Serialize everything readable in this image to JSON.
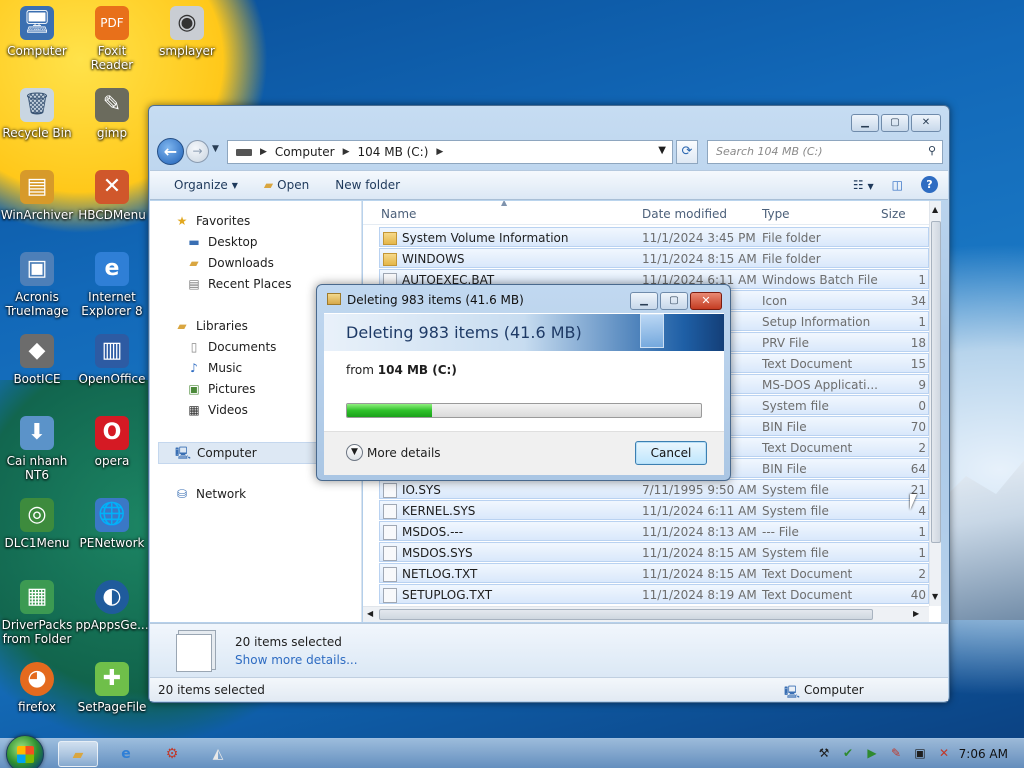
{
  "desktop": {
    "icons": [
      {
        "label": "Computer"
      },
      {
        "label": "Foxit Reader"
      },
      {
        "label": "smplayer"
      },
      {
        "label": "Recycle Bin"
      },
      {
        "label": "gimp"
      },
      {
        "label": "WinArchiver"
      },
      {
        "label": "HBCDMenu"
      },
      {
        "label": "Acronis TrueImage"
      },
      {
        "label": "Internet Explorer 8"
      },
      {
        "label": "BootICE"
      },
      {
        "label": "OpenOffice"
      },
      {
        "label": "Cai nhanh NT6"
      },
      {
        "label": "opera"
      },
      {
        "label": "DLC1Menu"
      },
      {
        "label": "PENetwork"
      },
      {
        "label": "DriverPacks from Folder"
      },
      {
        "label": "ppAppsGe..."
      },
      {
        "label": "firefox"
      },
      {
        "label": "SetPageFile"
      }
    ]
  },
  "explorer": {
    "breadcrumb": [
      "Computer",
      "104 MB (C:)"
    ],
    "search_placeholder": "Search 104 MB (C:)",
    "toolbar": {
      "organize": "Organize",
      "open": "Open",
      "new_folder": "New folder"
    },
    "nav": {
      "favorites": "Favorites",
      "desktop": "Desktop",
      "downloads": "Downloads",
      "recent": "Recent Places",
      "libraries": "Libraries",
      "documents": "Documents",
      "music": "Music",
      "pictures": "Pictures",
      "videos": "Videos",
      "computer": "Computer",
      "network": "Network"
    },
    "columns": {
      "name": "Name",
      "date": "Date modified",
      "type": "Type",
      "size": "Size"
    },
    "files": [
      {
        "name": "System Volume Information",
        "date": "11/1/2024 3:45 PM",
        "type": "File folder",
        "size": ""
      },
      {
        "name": "WINDOWS",
        "date": "11/1/2024 8:15 AM",
        "type": "File folder",
        "size": ""
      },
      {
        "name": "AUTOEXEC.BAT",
        "date": "11/1/2024 6:11 AM",
        "type": "Windows Batch File",
        "size": "1"
      },
      {
        "name": "",
        "date": "M",
        "type": "Icon",
        "size": "34"
      },
      {
        "name": "",
        "date": "M",
        "type": "Setup Information",
        "size": "1"
      },
      {
        "name": "",
        "date": "M",
        "type": "PRV File",
        "size": "18"
      },
      {
        "name": "",
        "date": "M",
        "type": "Text Document",
        "size": "15"
      },
      {
        "name": "",
        "date": "M",
        "type": "MS-DOS Applicati...",
        "size": "9"
      },
      {
        "name": "",
        "date": "M",
        "type": "System file",
        "size": "0"
      },
      {
        "name": "",
        "date": "M",
        "type": "BIN File",
        "size": "70"
      },
      {
        "name": "",
        "date": "M",
        "type": "Text Document",
        "size": "2"
      },
      {
        "name": "",
        "date": "M",
        "type": "BIN File",
        "size": "64"
      },
      {
        "name": "IO.SYS",
        "date": "7/11/1995 9:50 AM",
        "type": "System file",
        "size": "21"
      },
      {
        "name": "KERNEL.SYS",
        "date": "11/1/2024 6:11 AM",
        "type": "System file",
        "size": "4"
      },
      {
        "name": "MSDOS.---",
        "date": "11/1/2024 8:13 AM",
        "type": "--- File",
        "size": "1"
      },
      {
        "name": "MSDOS.SYS",
        "date": "11/1/2024 8:15 AM",
        "type": "System file",
        "size": "1"
      },
      {
        "name": "NETLOG.TXT",
        "date": "11/1/2024 8:15 AM",
        "type": "Text Document",
        "size": "2"
      },
      {
        "name": "SETUPLOG.TXT",
        "date": "11/1/2024 8:19 AM",
        "type": "Text Document",
        "size": "40"
      }
    ],
    "details": {
      "count": "20 items selected",
      "show_more": "Show more details..."
    },
    "status": {
      "left": "20 items selected",
      "right": "Computer"
    }
  },
  "dialog": {
    "title": "Deleting 983 items (41.6 MB)",
    "heading": "Deleting 983 items (41.6 MB)",
    "from_label": "from",
    "from_value": "104 MB (C:)",
    "progress": 0.24,
    "more_details": "More details",
    "cancel": "Cancel"
  },
  "taskbar": {
    "clock": "7:06 AM"
  }
}
